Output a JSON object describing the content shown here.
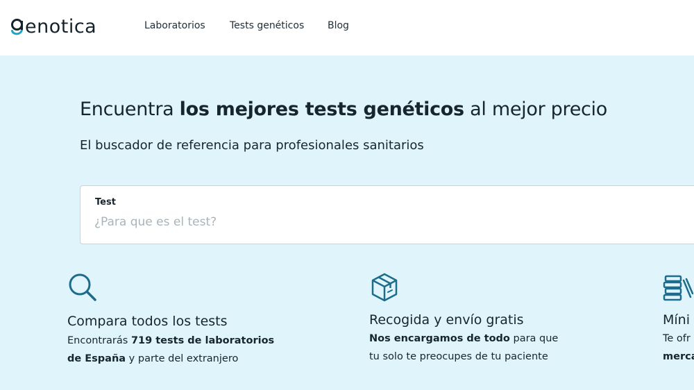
{
  "header": {
    "logo_text": "enotica",
    "logo_initial": "g",
    "nav": [
      {
        "label": "Laboratorios"
      },
      {
        "label": "Tests genéticos"
      },
      {
        "label": "Blog"
      }
    ]
  },
  "hero": {
    "headline_pre": "Encuentra ",
    "headline_bold": "los mejores tests genéticos",
    "headline_post": " al mejor precio",
    "subheadline": "El buscador de referencia para profesionales sanitarios",
    "search": {
      "label": "Test",
      "placeholder": "¿Para que es el test?",
      "value": ""
    }
  },
  "features": [
    {
      "icon": "magnifier-icon",
      "title": "Compara todos los tests",
      "line1_pre": "Encontrarás ",
      "line1_bold": "719 tests de laboratorios",
      "line2_bold": "de España",
      "line2_post": " y parte del extranjero"
    },
    {
      "icon": "box-icon",
      "title": "Recogida y envío gratis",
      "line1_bold": "Nos encargamos de todo",
      "line1_post": " para que",
      "line2": "tu solo te preocupes de tu paciente"
    },
    {
      "icon": "books-icon",
      "title": "Míni",
      "line1": "Te ofr",
      "line2_bold": "merca"
    }
  ],
  "colors": {
    "brand_teal": "#1aa6c7",
    "hero_background": "#dff4fb",
    "icon_blue": "#1d6c8c",
    "text_dark": "#17252e"
  }
}
